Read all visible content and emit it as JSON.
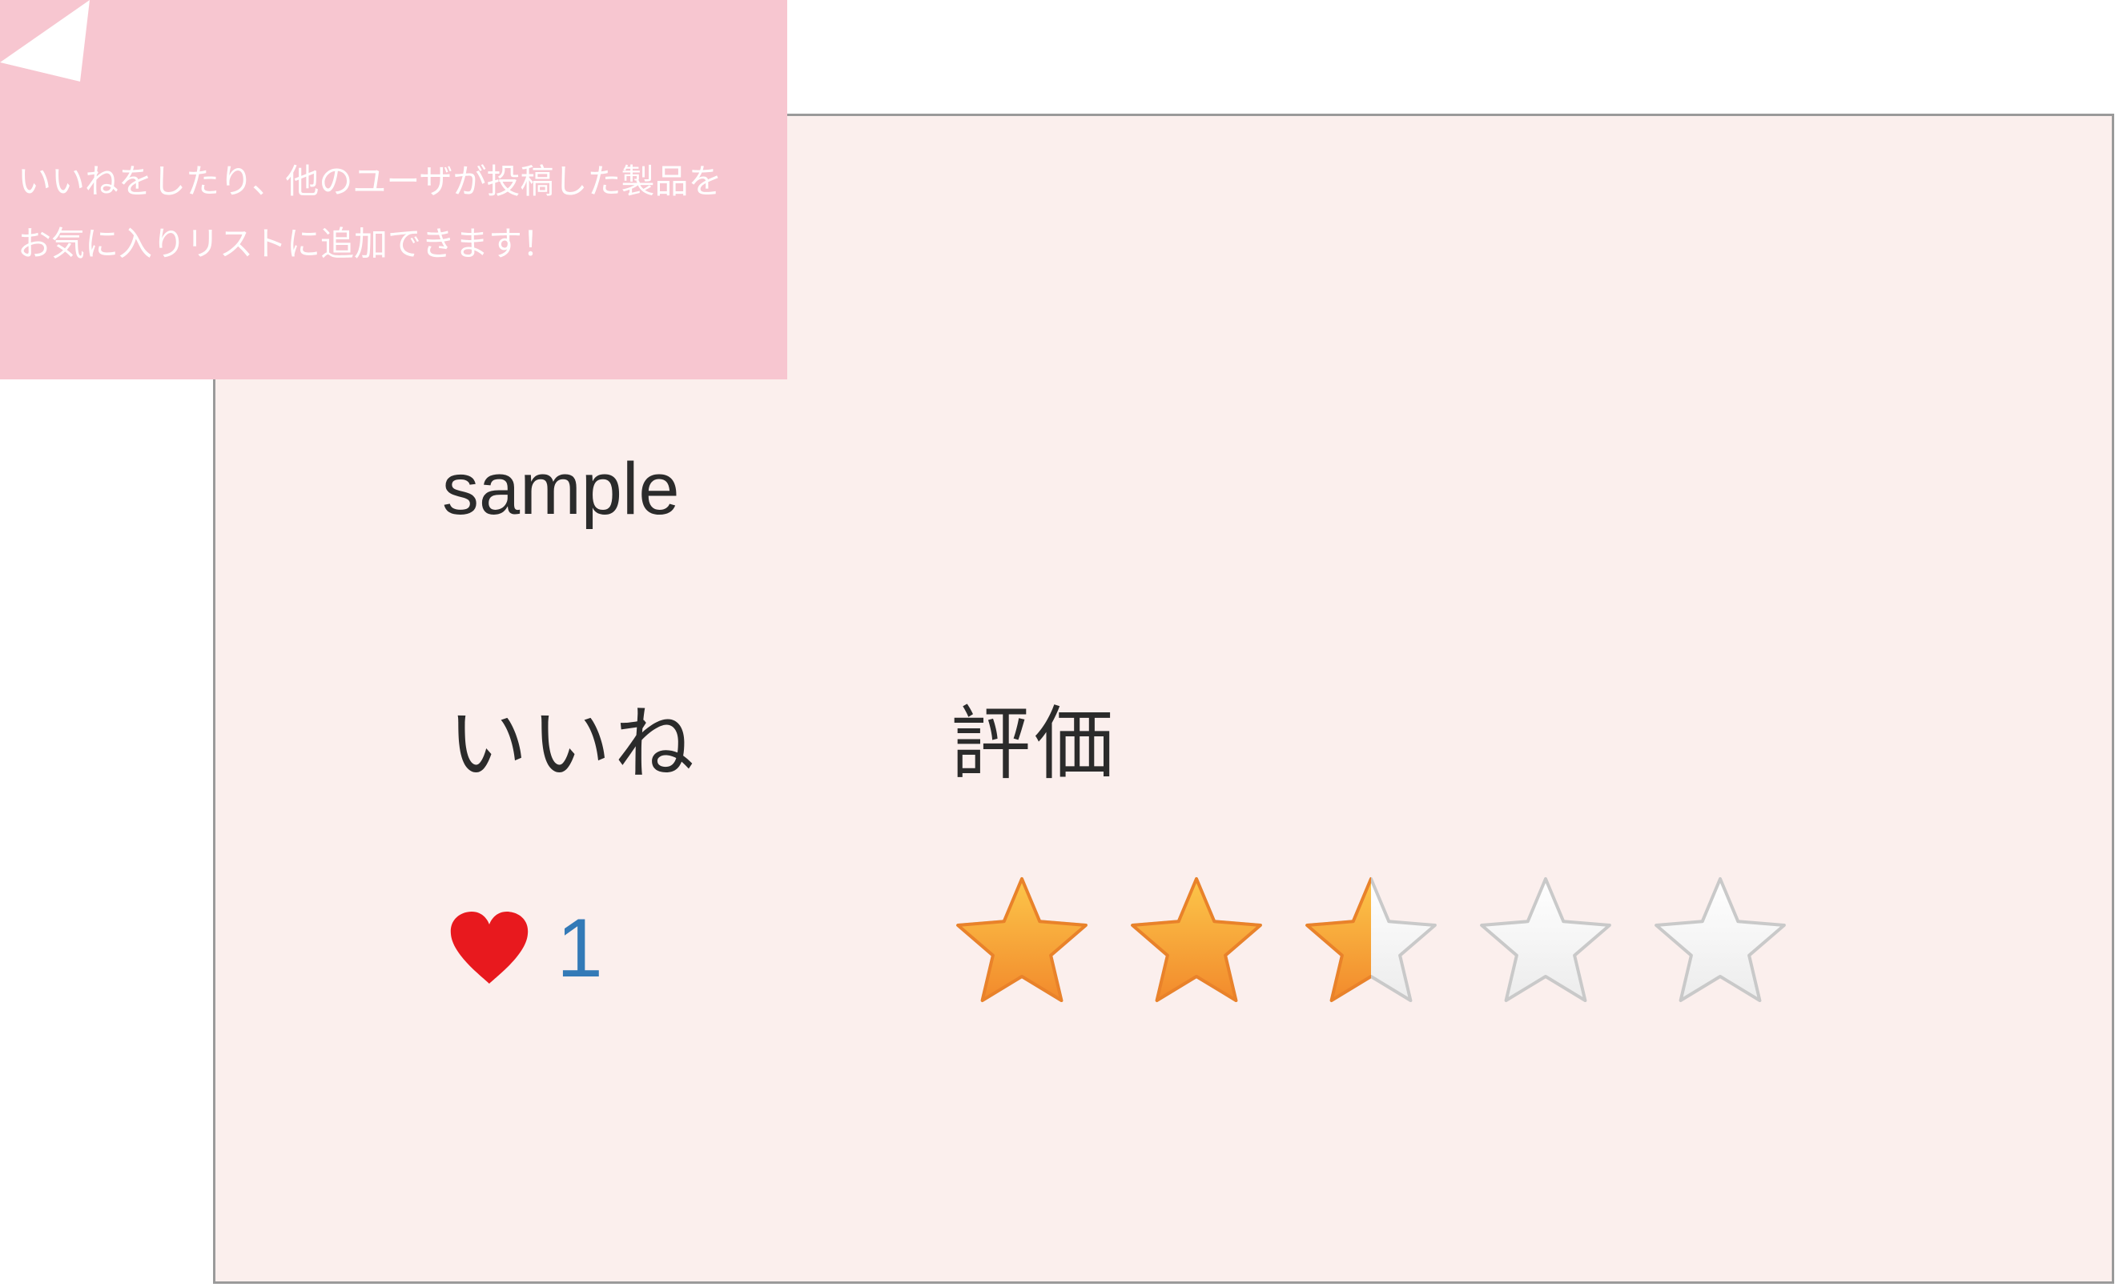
{
  "tooltip": {
    "text": "いいねをしたり、他のユーザが投稿した製品を\nお気に入りリストに追加できます！"
  },
  "product": {
    "name": "sample"
  },
  "like": {
    "heading": "いいね",
    "count": "1",
    "icon": "heart-icon",
    "color": "#e8191e"
  },
  "rating": {
    "heading": "評価",
    "value": 2.5,
    "max": 5,
    "icon": "star-icon",
    "filled_color": "#f7a23a",
    "empty_color": "#ffffff"
  },
  "colors": {
    "card_background": "#fbefed",
    "tooltip_background": "#f7c6d0",
    "count_color": "#337ab7"
  }
}
